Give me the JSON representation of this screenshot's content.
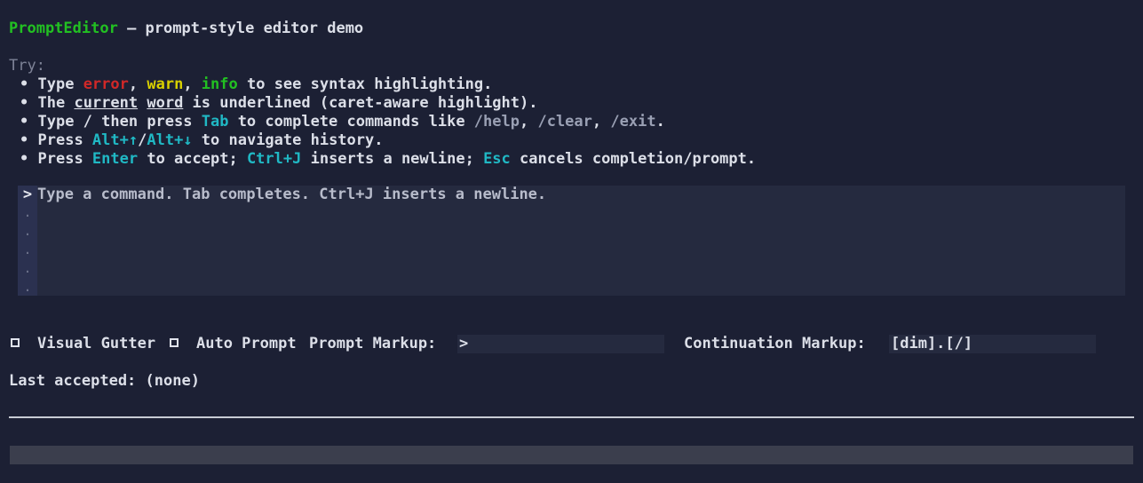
{
  "header": {
    "app_name": "PromptEditor",
    "subtitle": " – prompt-style editor demo"
  },
  "help": {
    "try_label": "Try:",
    "bullet": "•",
    "line1": {
      "a": "Type ",
      "error": "error",
      "b": ", ",
      "warn": "warn",
      "c": ", ",
      "info": "info",
      "d": " to see syntax highlighting."
    },
    "line2": {
      "a": "The ",
      "current": "current",
      "b": " ",
      "word": "word",
      "c": " is underlined (caret-aware highlight)."
    },
    "line3": {
      "a": "Type / then press ",
      "tab": "Tab",
      "b": " to complete commands like ",
      "help": "/help",
      "c": ", ",
      "clear": "/clear",
      "d": ", ",
      "exit": "/exit",
      "e": "."
    },
    "line4": {
      "a": "Press ",
      "up": "Alt+↑",
      "sep": "/",
      "down": "Alt+↓",
      "b": " to navigate history."
    },
    "line5": {
      "a": "Press ",
      "enter": "Enter",
      "b": " to accept; ",
      "ctrlj": "Ctrl+J",
      "c": " inserts a newline; ",
      "esc": "Esc",
      "d": " cancels completion/prompt."
    }
  },
  "editor": {
    "prompt_glyph": ">",
    "continuation_glyph": ".",
    "placeholder": "Type a command. Tab completes. Ctrl+J inserts a newline."
  },
  "options": {
    "visual_gutter_label": "Visual Gutter",
    "auto_prompt_label": "Auto Prompt",
    "prompt_markup_label": "Prompt Markup:",
    "prompt_markup_value": ">",
    "continuation_markup_label": "Continuation Markup:",
    "continuation_markup_value": "[dim].[/]"
  },
  "status": {
    "last_accepted_label": "Last accepted:",
    "last_accepted_value": "(none)"
  }
}
